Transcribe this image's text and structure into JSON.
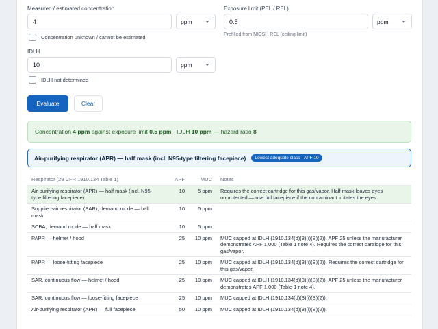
{
  "form": {
    "concentration_label": "Measured / estimated concentration",
    "concentration_value": "4",
    "concentration_unit": "ppm",
    "unknown_label": "Concentration unknown / cannot be estimated",
    "exposure_label": "Exposure limit (PEL / REL)",
    "exposure_value": "0.5",
    "exposure_unit": "ppm",
    "exposure_hint": "Prefilled from NIOSH REL (ceiling limit)",
    "idlh_label": "IDLH",
    "idlh_value": "10",
    "idlh_unit": "ppm",
    "idlh_undetermined_label": "IDLH not determined",
    "evaluate_label": "Evaluate",
    "clear_label": "Clear"
  },
  "summary": {
    "text_1": "Concentration",
    "concentration": "4 ppm",
    "text_2": "against exposure limit",
    "limit": "0.5 ppm",
    "text_3": "· IDLH",
    "idlh": "10 ppm",
    "text_4": "— hazard ratio",
    "ratio": "8"
  },
  "recommendation": {
    "title": "Air-purifying respirator (APR) — half mask (incl. N95-type filtering facepiece)",
    "badge": "Lowest adequate class · APF 10"
  },
  "table": {
    "headers": {
      "respirator": "Respirator (29 CFR 1910.134 Table 1)",
      "apf": "APF",
      "muc": "MUC",
      "notes": "Notes"
    },
    "rows": [
      {
        "respirator": "Air-purifying respirator (APR) — half mask (incl. N95-type filtering facepiece)",
        "apf": "10",
        "muc": "5 ppm",
        "notes": "Requires the correct cartridge for this gas/vapor. Half mask leaves eyes unprotected — use full facepiece if the contaminant irritates the eyes."
      },
      {
        "respirator": "Supplied-air respirator (SAR), demand mode — half mask",
        "apf": "10",
        "muc": "5 ppm",
        "notes": ""
      },
      {
        "respirator": "SCBA, demand mode — half mask",
        "apf": "10",
        "muc": "5 ppm",
        "notes": ""
      },
      {
        "respirator": "PAPR — helmet / hood",
        "apf": "25",
        "muc": "10 ppm",
        "notes": "MUC capped at IDLH (1910.134(d)(3)(i)(B)(2)). APF 25 unless the manufacturer demonstrates APF 1,000 (Table 1 note 4). Requires the correct cartridge for this gas/vapor."
      },
      {
        "respirator": "PAPR — loose-fitting facepiece",
        "apf": "25",
        "muc": "10 ppm",
        "notes": "MUC capped at IDLH (1910.134(d)(3)(i)(B)(2)). Requires the correct cartridge for this gas/vapor."
      },
      {
        "respirator": "SAR, continuous flow — helmet / hood",
        "apf": "25",
        "muc": "10 ppm",
        "notes": "MUC capped at IDLH (1910.134(d)(3)(i)(B)(2)). APF 25 unless the manufacturer demonstrates APF 1,000 (Table 1 note 4)."
      },
      {
        "respirator": "SAR, continuous flow — loose-fitting facepiece",
        "apf": "25",
        "muc": "10 ppm",
        "notes": "MUC capped at IDLH (1910.134(d)(3)(i)(B)(2))."
      },
      {
        "respirator": "Air-purifying respirator (APR) — full facepiece",
        "apf": "50",
        "muc": "10 ppm",
        "notes": "MUC capped at IDLH (1910.134(d)(3)(i)(B)(2))."
      }
    ]
  },
  "colors": {
    "primary": "#1565c0",
    "success_bg": "#eaf5ea",
    "success_text": "#1b5e20",
    "highlight_row": "#e9f5e9"
  }
}
